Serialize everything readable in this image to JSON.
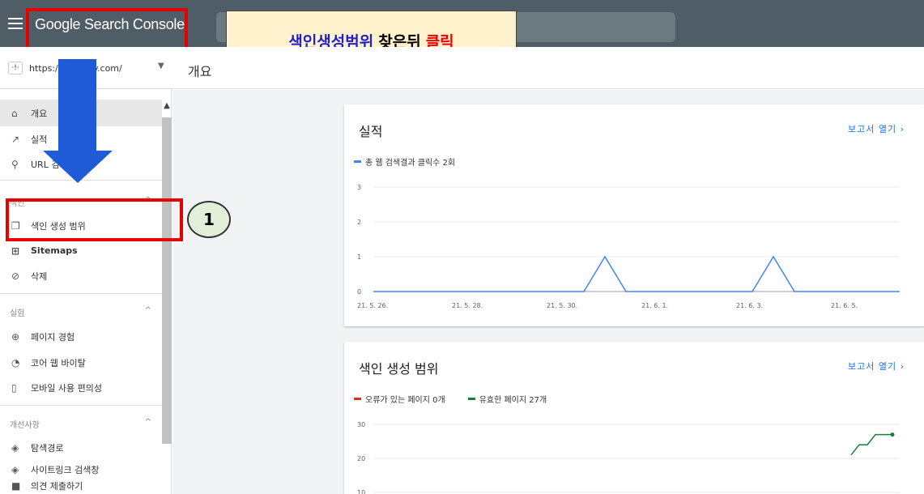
{
  "header": {
    "brand": "Google Search Console",
    "callout": {
      "part1": "색인생성범위",
      "part2": "찾은뒤",
      "part3": "클릭"
    }
  },
  "property": {
    "icon": "·!·",
    "url": "https://…tistory.com/"
  },
  "page_title": "개요",
  "sidebar": {
    "items": [
      {
        "label": "개요",
        "icon": "home-icon"
      },
      {
        "label": "실적",
        "icon": "trending-icon"
      },
      {
        "label": "URL 검사",
        "icon": "search-icon"
      }
    ],
    "index_section": "색인",
    "index_items": [
      {
        "label": "색인 생성 범위",
        "icon": "copy-icon"
      },
      {
        "label": "Sitemaps",
        "icon": "sitemap-icon"
      },
      {
        "label": "삭제",
        "icon": "eye-off-icon"
      }
    ],
    "experience_section": "실험",
    "experience_items": [
      {
        "label": "페이지 경험",
        "icon": "plus-circle-icon"
      },
      {
        "label": "코어 웹 바이탈",
        "icon": "gauge-icon"
      },
      {
        "label": "모바일 사용 편의성",
        "icon": "phone-icon"
      }
    ],
    "enhancement_section": "개선사항",
    "enhancement_items": [
      {
        "label": "탐색경로",
        "icon": "layers-icon"
      },
      {
        "label": "사이트링크 검색창",
        "icon": "layers-icon"
      }
    ],
    "feedback": "의견 제출하기"
  },
  "step_badge": "1",
  "cards": {
    "performance": {
      "title": "실적",
      "link": "보고서 열기",
      "legend": "총 웹 검색결과 클릭수 2회"
    },
    "coverage": {
      "title": "색인 생성 범위",
      "link": "보고서 열기",
      "legend_error": "오류가 있는 페이지 0개",
      "legend_valid": "유효한 페이지 27개"
    }
  },
  "colors": {
    "clicks": "#4285f4",
    "error": "#d93025",
    "valid": "#188038",
    "annotation": "#e60000"
  },
  "chart_data": [
    {
      "type": "line",
      "title": "실적",
      "series": [
        {
          "name": "총 웹 검색결과 클릭수 2회",
          "values": [
            0,
            0,
            0,
            0,
            0,
            0,
            0,
            0,
            0,
            0,
            0,
            1,
            0,
            0,
            0,
            0,
            0,
            0,
            0,
            1,
            0,
            0,
            0,
            0,
            0,
            0
          ]
        }
      ],
      "x_ticks": [
        "21. 5. 26.",
        "21. 5. 28.",
        "21. 5. 30.",
        "21. 6. 1.",
        "21. 6. 3.",
        "21. 6. 5."
      ],
      "y_ticks": [
        "0",
        "1",
        "2",
        "3"
      ],
      "ylim": [
        0,
        3
      ]
    },
    {
      "type": "line",
      "title": "색인 생성 범위",
      "series": [
        {
          "name": "유효한 페이지 27개",
          "values": [
            21,
            24,
            24,
            27,
            27
          ]
        }
      ],
      "y_ticks": [
        "10",
        "20",
        "30"
      ]
    }
  ]
}
